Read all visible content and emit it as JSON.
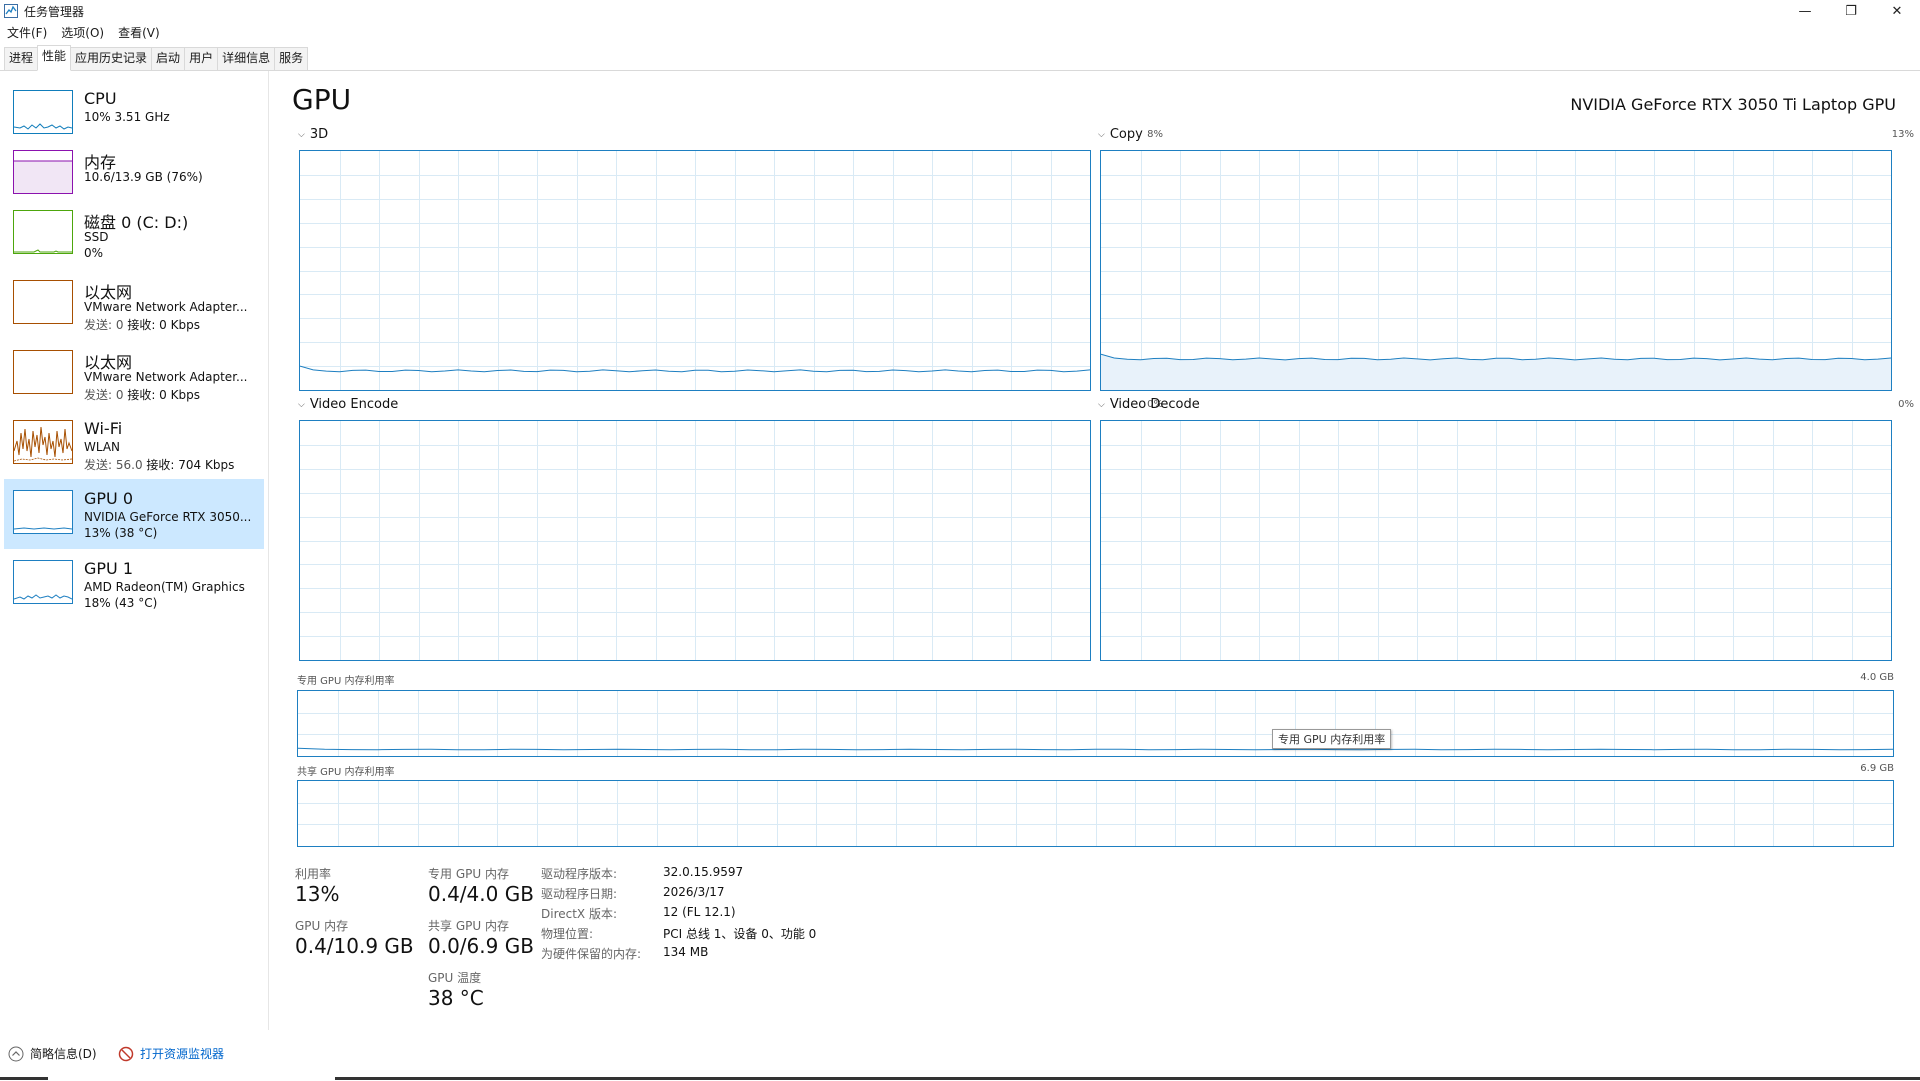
{
  "window": {
    "title": "任务管理器",
    "minimize": "—",
    "maximize": "❐",
    "close": "✕"
  },
  "menu": [
    "文件(F)",
    "选项(O)",
    "查看(V)"
  ],
  "tabs": [
    "进程",
    "性能",
    "应用历史记录",
    "启动",
    "用户",
    "详细信息",
    "服务"
  ],
  "active_tab": "性能",
  "sidebar": [
    {
      "title": "CPU",
      "line1": "10% 3.51 GHz",
      "line2": "",
      "color": "#117dbb"
    },
    {
      "title": "内存",
      "line1": "10.6/13.9 GB (76%)",
      "line2": "",
      "color": "#8b12ae"
    },
    {
      "title": "磁盘 0 (C: D:)",
      "line1": "SSD",
      "line2": "0%",
      "color": "#4da60c"
    },
    {
      "title": "以太网",
      "line1": "VMware Network Adapter...",
      "line2_send": "发送: 0",
      "line2_recv": "接收: 0 Kbps",
      "color": "#a74f01"
    },
    {
      "title": "以太网",
      "line1": "VMware Network Adapter...",
      "line2_send": "发送: 0",
      "line2_recv": "接收: 0 Kbps",
      "color": "#a74f01"
    },
    {
      "title": "Wi-Fi",
      "line1": "WLAN",
      "line2_send": "发送: 56.0",
      "line2_recv": "接收: 704 Kbps",
      "color": "#a74f01"
    },
    {
      "title": "GPU 0",
      "line1": "NVIDIA GeForce RTX 3050...",
      "line2": "13% (38 °C)",
      "color": "#1e7fc1"
    },
    {
      "title": "GPU 1",
      "line1": "AMD Radeon(TM) Graphics",
      "line2": "18% (43 °C)",
      "color": "#1e7fc1"
    }
  ],
  "gpu": {
    "title": "GPU",
    "model": "NVIDIA GeForce RTX 3050 Ti Laptop GPU",
    "engines": [
      {
        "name": "3D",
        "pct": "8%"
      },
      {
        "name": "Copy",
        "pct": "13%"
      },
      {
        "name": "Video Encode",
        "pct": "0%"
      },
      {
        "name": "Video Decode",
        "pct": "0%"
      }
    ],
    "dedicated_mem_label": "专用 GPU 内存利用率",
    "dedicated_mem_max": "4.0 GB",
    "shared_mem_label": "共享 GPU 内存利用率",
    "shared_mem_max": "6.9 GB",
    "tooltip": "专用 GPU 内存利用率",
    "graph_color": "#1e7fc1",
    "grid_color": "#d9eaf5"
  },
  "stats": {
    "utilization_label": "利用率",
    "utilization": "13%",
    "dedicated_label": "专用 GPU 内存",
    "dedicated": "0.4/4.0 GB",
    "gpu_mem_label": "GPU 内存",
    "gpu_mem": "0.4/10.9 GB",
    "shared_label": "共享 GPU 内存",
    "shared": "0.0/6.9 GB",
    "temp_label": "GPU 温度",
    "temp": "38 °C"
  },
  "details": [
    {
      "key": "驱动程序版本:",
      "val": "32.0.15.9597"
    },
    {
      "key": "驱动程序日期:",
      "val": "2026/3/17"
    },
    {
      "key": "DirectX 版本:",
      "val": "12 (FL 12.1)"
    },
    {
      "key": "物理位置:",
      "val": "PCI 总线 1、设备 0、功能 0"
    },
    {
      "key": "为硬件保留的内存:",
      "val": "134 MB"
    }
  ],
  "footer": {
    "fewer_details": "简略信息(D)",
    "open_monitor": "打开资源监视器"
  }
}
